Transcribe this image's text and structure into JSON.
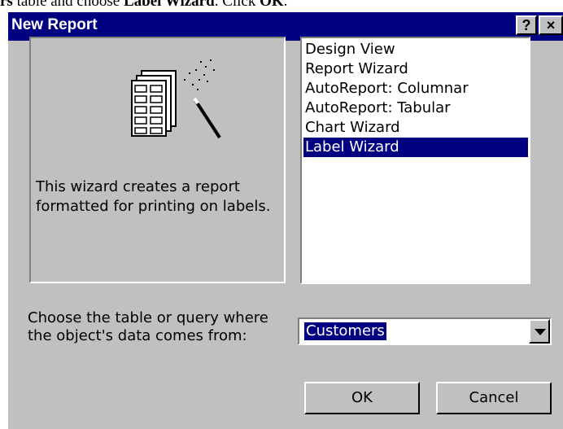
{
  "document": {
    "text_1": "rs",
    "text_2": " table and choose ",
    "text_3": "Label Wizard",
    "text_4": ".  Click ",
    "text_5": "OK",
    "text_6": "."
  },
  "dialog": {
    "title": "New Report",
    "help_label": "?",
    "close_label": "×"
  },
  "preview": {
    "icon": "label-wizard-icon",
    "description": "This wizard creates a report formatted for printing on labels."
  },
  "report_types": {
    "items": [
      "Design View",
      "Report Wizard",
      "AutoReport:  Columnar",
      "AutoReport:  Tabular",
      "Chart Wizard",
      "Label Wizard"
    ],
    "selected": "Label Wizard"
  },
  "source": {
    "label": "Choose the table or query where the object's data comes from:",
    "value": "Customers"
  },
  "buttons": {
    "ok": "OK",
    "cancel": "Cancel"
  },
  "colors": {
    "title_bar": "#000080",
    "selection": "#000080",
    "face": "#c0c0c0"
  }
}
